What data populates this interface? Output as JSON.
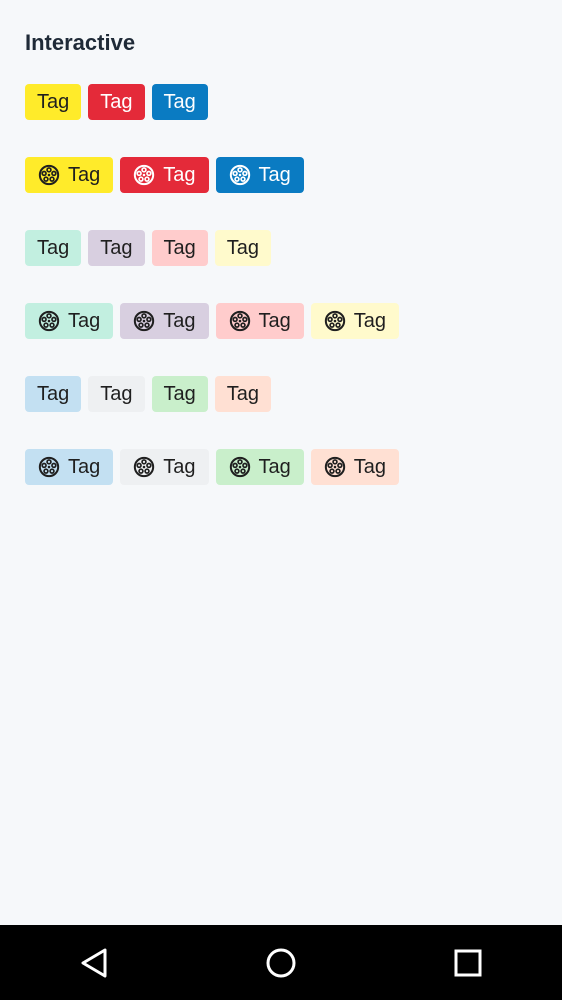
{
  "page": {
    "title": "Interactive"
  },
  "rows": [
    {
      "icon": false,
      "tags": [
        {
          "label": "Tag",
          "bg": "#ffeb2a",
          "color": "#1f1f1f"
        },
        {
          "label": "Tag",
          "bg": "#e42a39",
          "color": "#ffffff"
        },
        {
          "label": "Tag",
          "bg": "#0a7bc2",
          "color": "#ffffff"
        }
      ]
    },
    {
      "icon": true,
      "tags": [
        {
          "label": "Tag",
          "bg": "#ffeb2a",
          "color": "#1f1f1f"
        },
        {
          "label": "Tag",
          "bg": "#e42a39",
          "color": "#ffffff"
        },
        {
          "label": "Tag",
          "bg": "#0a7bc2",
          "color": "#ffffff"
        }
      ]
    },
    {
      "icon": false,
      "tags": [
        {
          "label": "Tag",
          "bg": "#c2efe0",
          "color": "#1f1f1f"
        },
        {
          "label": "Tag",
          "bg": "#d8cfe0",
          "color": "#1f1f1f"
        },
        {
          "label": "Tag",
          "bg": "#ffcccc",
          "color": "#1f1f1f"
        },
        {
          "label": "Tag",
          "bg": "#fffacc",
          "color": "#1f1f1f"
        }
      ]
    },
    {
      "icon": true,
      "tags": [
        {
          "label": "Tag",
          "bg": "#c2efe0",
          "color": "#1f1f1f"
        },
        {
          "label": "Tag",
          "bg": "#d8cfe0",
          "color": "#1f1f1f"
        },
        {
          "label": "Tag",
          "bg": "#ffcccc",
          "color": "#1f1f1f"
        },
        {
          "label": "Tag",
          "bg": "#fffacc",
          "color": "#1f1f1f"
        }
      ]
    },
    {
      "icon": false,
      "tags": [
        {
          "label": "Tag",
          "bg": "#c3e0f2",
          "color": "#1f1f1f"
        },
        {
          "label": "Tag",
          "bg": "#eef0f2",
          "color": "#1f1f1f"
        },
        {
          "label": "Tag",
          "bg": "#c9efcb",
          "color": "#1f1f1f"
        },
        {
          "label": "Tag",
          "bg": "#ffe0d3",
          "color": "#1f1f1f"
        }
      ]
    },
    {
      "icon": true,
      "tags": [
        {
          "label": "Tag",
          "bg": "#c3e0f2",
          "color": "#1f1f1f"
        },
        {
          "label": "Tag",
          "bg": "#eef0f2",
          "color": "#1f1f1f"
        },
        {
          "label": "Tag",
          "bg": "#c9efcb",
          "color": "#1f1f1f"
        },
        {
          "label": "Tag",
          "bg": "#ffe0d3",
          "color": "#1f1f1f"
        }
      ]
    }
  ],
  "tag_icon": "film-reel-icon",
  "navbar": {
    "back_icon": "back-triangle-icon",
    "home_icon": "home-circle-icon",
    "recents_icon": "recents-square-icon"
  }
}
